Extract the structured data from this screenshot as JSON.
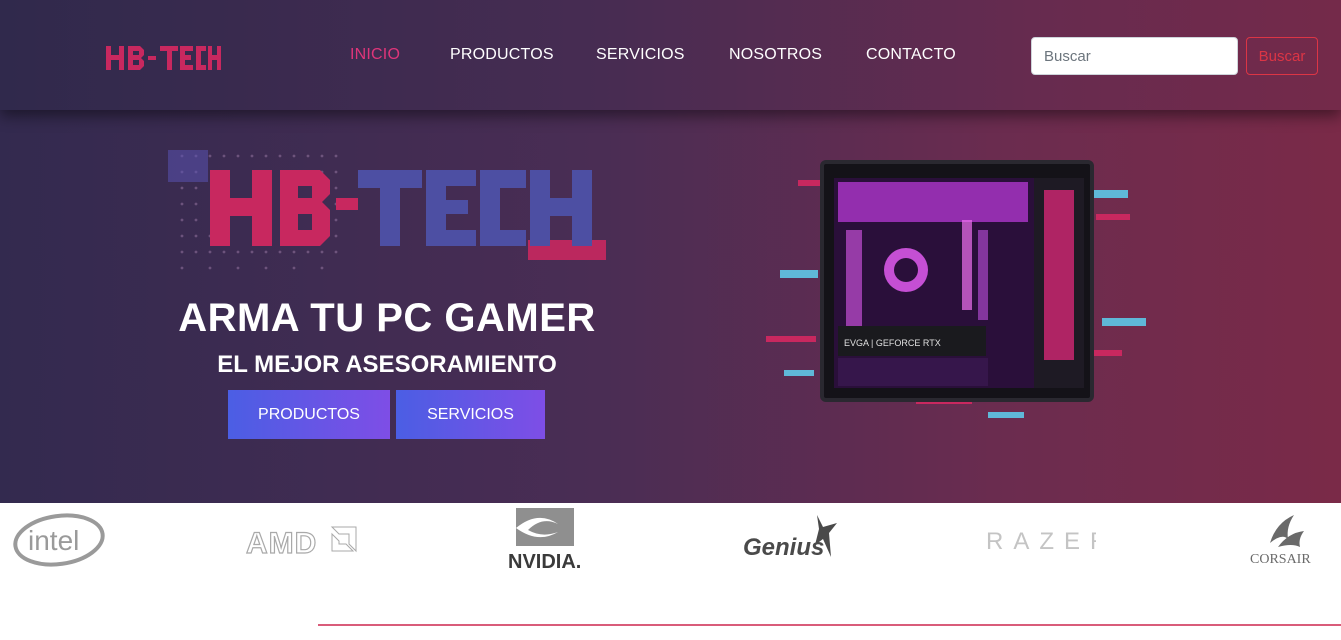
{
  "brand": {
    "logo_text": "HB-TECH"
  },
  "nav": {
    "items": [
      {
        "label": "INICIO",
        "active": true
      },
      {
        "label": "PRODUCTOS",
        "active": false
      },
      {
        "label": "SERVICIOS",
        "active": false
      },
      {
        "label": "NOSOTROS",
        "active": false
      },
      {
        "label": "CONTACTO",
        "active": false
      }
    ]
  },
  "search": {
    "placeholder": "Buscar",
    "value": "",
    "button_label": "Buscar"
  },
  "hero": {
    "logo_text": "HB-TECH",
    "title": "ARMA TU PC GAMER",
    "subtitle": "EL MEJOR ASESORAMIENTO",
    "buttons": [
      {
        "label": "PRODUCTOS"
      },
      {
        "label": "SERVICIOS"
      }
    ],
    "image_text": "EVGA | GEFORCE RTX"
  },
  "brands": [
    {
      "name": "intel"
    },
    {
      "name": "AMD"
    },
    {
      "name": "NVIDIA."
    },
    {
      "name": "Genius"
    },
    {
      "name": "RAZER"
    },
    {
      "name": "CORSAIR"
    }
  ],
  "colors": {
    "accent": "#e0357a",
    "search_button": "#dc3545",
    "hero_button_start": "#4b5ee4",
    "hero_button_end": "#7e4ee6",
    "logo_pink": "#c8285f",
    "logo_blue": "#4d4fa3"
  }
}
